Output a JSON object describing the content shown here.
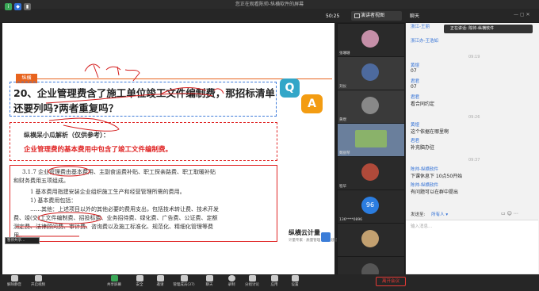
{
  "window": {
    "title": "您正在观看陈帅-纵横软件的屏幕"
  },
  "topbar": {
    "timer": "50:25",
    "view_label": "演讲者视图",
    "chat_dropdown": "聊天"
  },
  "slide": {
    "logo": "纵横",
    "question_line1": "20、企业管理费含了施工单位竣工文件编制费，那招标清单",
    "question_line2": "还要列吗?两者重复吗？",
    "q_icon": "Q",
    "a_icon": "A",
    "answer_title": "纵横呆小瓜解析（仅供参考）：",
    "answer_text": "企业管理费的基本费用中包含了竣工文件编制费。",
    "doc_lines": [
      "3.1.7  企业管理费由基本费用、主副食运费补贴、职工探亲路费、职工取暖补贴",
      "和财务费用五项组成。",
      "1  基本费用指建安装企业组织施工生产和经营管理所需的费用。",
      "1) 基本费用包括：",
      "……其他：上述项目以外的其他必要的费用支出，包括技术转让费、技术开发",
      "费、竣(交)工文件编制费、招投标费、业务招待费、绿化费、广告费、公证费、定额",
      "测定费、法律顾问费、审计费、咨询费以及施工标准化、规范化、精细化管理等费",
      "用。"
    ],
    "brand_name": "纵横云计量",
    "brand_sub": "计量专家 · 质量管理 · 精益建造",
    "preview_label": "暂停共享…"
  },
  "gallery": {
    "tiles": [
      {
        "name": "张珊珊",
        "avatar_color": "#c58fa8"
      },
      {
        "name": "刘仪",
        "avatar_color": "#4d6a9e"
      },
      {
        "name": "黄煜",
        "avatar_color": "#888888"
      },
      {
        "name": "魏丽琴",
        "avatar_color": "#8ab26a"
      },
      {
        "name": "程华",
        "avatar_color": "#b04a3a"
      },
      {
        "name": "136****0896",
        "avatar_color": "#2b7de0",
        "initials": "96"
      },
      {
        "name": "",
        "avatar_color": "#c2a070"
      },
      {
        "name": "韩跃龙老师",
        "avatar_color": "#2a2a2a"
      }
    ]
  },
  "chat": {
    "speaking": "正在讲话: 陈帅-纵横软件",
    "messages": [
      {
        "sender": "浙江-王丽",
        "text": ""
      },
      {
        "sender": "浙江办-王浩如",
        "text": ""
      },
      {
        "sender": "",
        "text": "",
        "time": "09:19"
      },
      {
        "sender": "黄煜",
        "text": "07"
      },
      {
        "sender": "君君",
        "text": "07"
      },
      {
        "sender": "君君",
        "text": "看合同约定"
      },
      {
        "sender": "",
        "text": "",
        "time": "09:26"
      },
      {
        "sender": "黄煜",
        "text": "这个依据在哪里啊"
      },
      {
        "sender": "君君",
        "text": "补充脑办驻"
      },
      {
        "sender": "",
        "text": "",
        "time": "09:37"
      },
      {
        "sender": "陈帅-纵横软件",
        "text": "下课休息下  10点50开始"
      },
      {
        "sender": "陈帅-纵横软件",
        "text": "有问题可以在群中提出"
      }
    ],
    "send_to_label": "发送至:",
    "send_to_value": "所有人",
    "input_placeholder": "输入消息…",
    "hint": "发送文件"
  },
  "bottombar": {
    "buttons": [
      "解除静音",
      "开启视频",
      "共享屏幕",
      "安全",
      "邀请",
      "管理成员(37)",
      "聊天",
      "录制",
      "分组讨论",
      "应用",
      "设置"
    ],
    "leave_label": "离开会议"
  }
}
